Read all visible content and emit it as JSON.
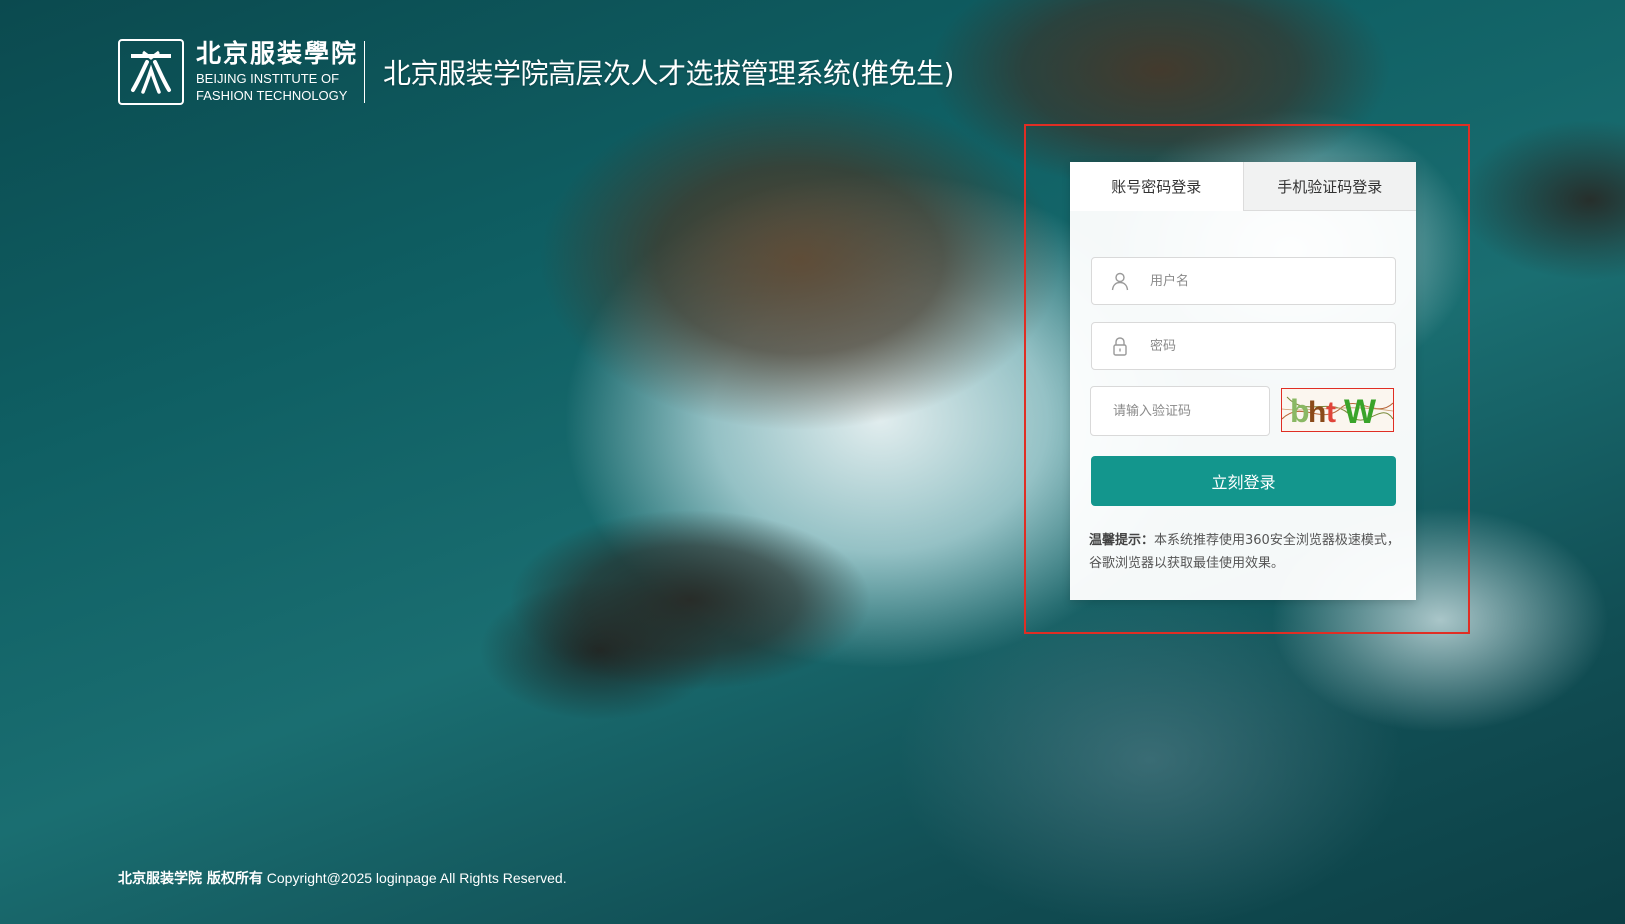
{
  "header": {
    "logo_cn": "北京服装學院",
    "logo_en_line1": "BEIJING INSTITUTE OF",
    "logo_en_line2": "FASHION TECHNOLOGY",
    "system_title": "北京服装学院高层次人才选拔管理系统(推免生)"
  },
  "login": {
    "tabs": [
      {
        "label": "账号密码登录",
        "active": true
      },
      {
        "label": "手机验证码登录",
        "active": false
      }
    ],
    "username_placeholder": "用户名",
    "password_placeholder": "密码",
    "captcha_placeholder": "请输入验证码",
    "captcha_text": "bhtW",
    "submit_label": "立刻登录",
    "tip_label": "温馨提示：",
    "tip_text": "本系统推荐使用360安全浏览器极速模式，谷歌浏览器以获取最佳使用效果。"
  },
  "footer": {
    "owner": "北京服装学院 版权所有",
    "copyright": "Copyright@2025 loginpage All Rights Reserved."
  },
  "colors": {
    "primary": "#13968d",
    "highlight_frame": "#e02e24",
    "panel_bg": "#ffffff"
  },
  "icons": {
    "logo": "bift-emblem-icon",
    "username": "user-icon",
    "password": "lock-icon"
  }
}
